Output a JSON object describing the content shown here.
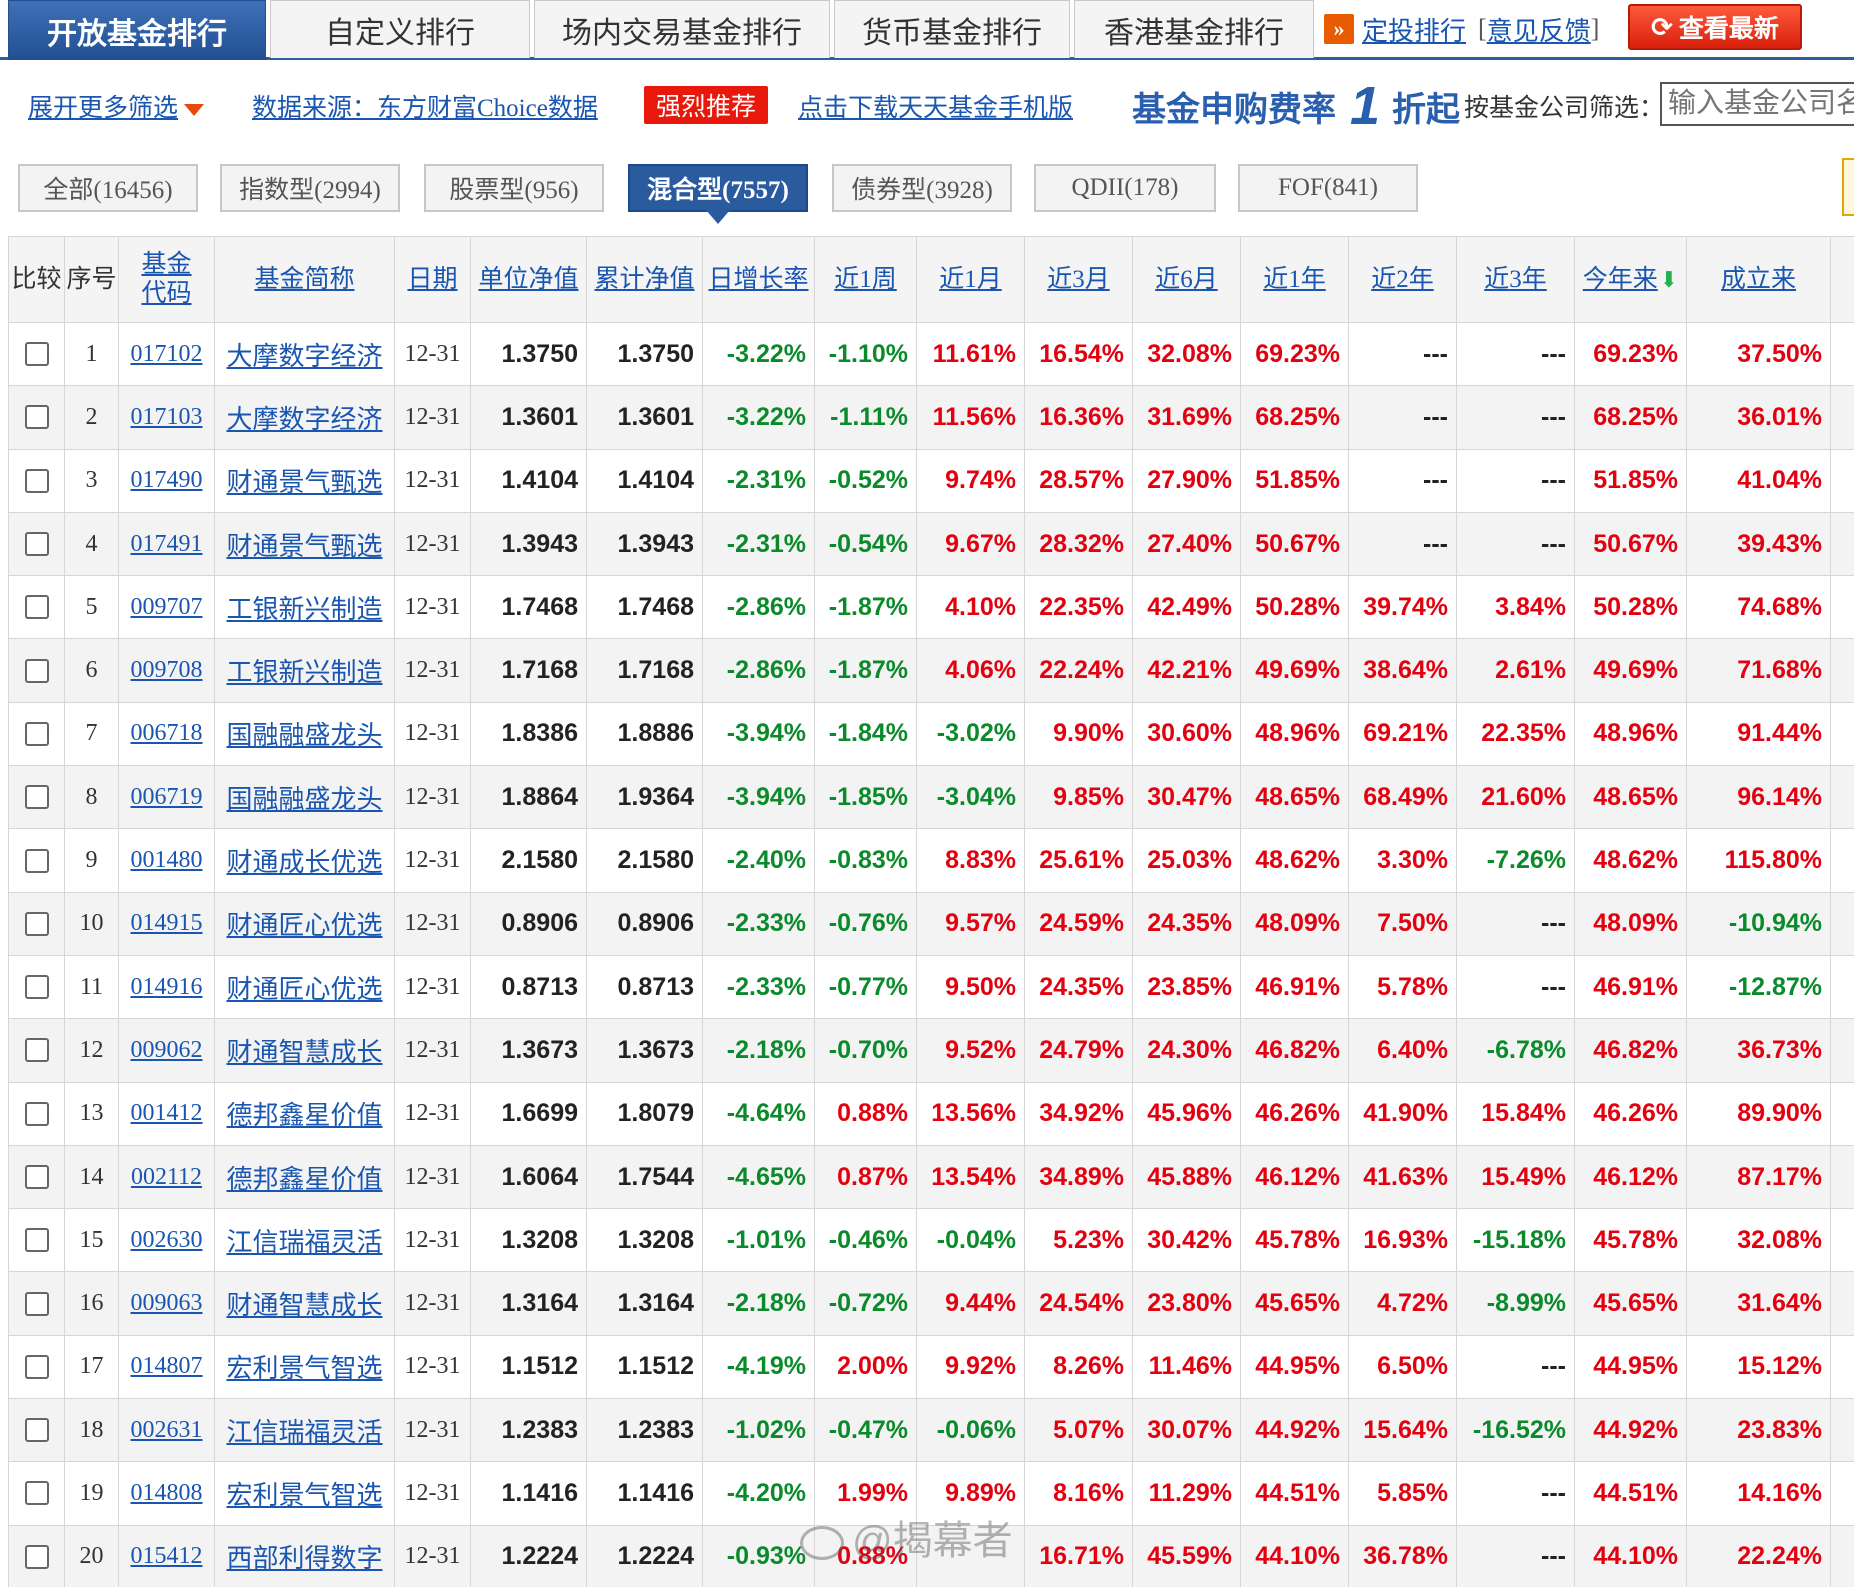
{
  "tabs": [
    "开放基金排行",
    "自定义排行",
    "场内交易基金排行",
    "货币基金排行",
    "香港基金排行"
  ],
  "top_links": {
    "dingtou": "定投排行",
    "feedback_open": "[",
    "feedback": "意见反馈",
    "feedback_close": "]"
  },
  "refresh_label": "查看最新",
  "filter": {
    "expand": "展开更多筛选",
    "source": "数据来源：东方财富Choice数据",
    "recommend": "强烈推荐",
    "download": "点击下载天天基金手机版",
    "fee_text": "基金申购费率",
    "fee_one": "1",
    "fee_suffix": "折起",
    "company_label": "按基金公司筛选：",
    "company_placeholder": "输入基金公司名称"
  },
  "categories": [
    "全部(16456)",
    "指数型(2994)",
    "股票型(956)",
    "混合型(7557)",
    "债券型(3928)",
    "QDII(178)",
    "FOF(841)"
  ],
  "headers": {
    "compare": "比较",
    "no": "序号",
    "code": "基金代码",
    "name": "基金简称",
    "date": "日期",
    "nav": "单位净值",
    "acc_nav": "累计净值",
    "daily": "日增长率",
    "w1": "近1周",
    "m1": "近1月",
    "m3": "近3月",
    "m6": "近6月",
    "y1": "近1年",
    "y2": "近2年",
    "y3": "近3年",
    "ytd": "今年来",
    "since": "成立来"
  },
  "rows": [
    {
      "no": "1",
      "code": "017102",
      "name": "大摩数字经济",
      "date": "12-31",
      "nav": "1.3750",
      "acc": "1.3750",
      "daily": "-3.22%",
      "w1": "-1.10%",
      "m1": "11.61%",
      "m3": "16.54%",
      "m6": "32.08%",
      "y1": "69.23%",
      "y2": "---",
      "y3": "---",
      "ytd": "69.23%",
      "since": "37.50%"
    },
    {
      "no": "2",
      "code": "017103",
      "name": "大摩数字经济",
      "date": "12-31",
      "nav": "1.3601",
      "acc": "1.3601",
      "daily": "-3.22%",
      "w1": "-1.11%",
      "m1": "11.56%",
      "m3": "16.36%",
      "m6": "31.69%",
      "y1": "68.25%",
      "y2": "---",
      "y3": "---",
      "ytd": "68.25%",
      "since": "36.01%"
    },
    {
      "no": "3",
      "code": "017490",
      "name": "财通景气甄选",
      "date": "12-31",
      "nav": "1.4104",
      "acc": "1.4104",
      "daily": "-2.31%",
      "w1": "-0.52%",
      "m1": "9.74%",
      "m3": "28.57%",
      "m6": "27.90%",
      "y1": "51.85%",
      "y2": "---",
      "y3": "---",
      "ytd": "51.85%",
      "since": "41.04%"
    },
    {
      "no": "4",
      "code": "017491",
      "name": "财通景气甄选",
      "date": "12-31",
      "nav": "1.3943",
      "acc": "1.3943",
      "daily": "-2.31%",
      "w1": "-0.54%",
      "m1": "9.67%",
      "m3": "28.32%",
      "m6": "27.40%",
      "y1": "50.67%",
      "y2": "---",
      "y3": "---",
      "ytd": "50.67%",
      "since": "39.43%"
    },
    {
      "no": "5",
      "code": "009707",
      "name": "工银新兴制造",
      "date": "12-31",
      "nav": "1.7468",
      "acc": "1.7468",
      "daily": "-2.86%",
      "w1": "-1.87%",
      "m1": "4.10%",
      "m3": "22.35%",
      "m6": "42.49%",
      "y1": "50.28%",
      "y2": "39.74%",
      "y3": "3.84%",
      "ytd": "50.28%",
      "since": "74.68%"
    },
    {
      "no": "6",
      "code": "009708",
      "name": "工银新兴制造",
      "date": "12-31",
      "nav": "1.7168",
      "acc": "1.7168",
      "daily": "-2.86%",
      "w1": "-1.87%",
      "m1": "4.06%",
      "m3": "22.24%",
      "m6": "42.21%",
      "y1": "49.69%",
      "y2": "38.64%",
      "y3": "2.61%",
      "ytd": "49.69%",
      "since": "71.68%"
    },
    {
      "no": "7",
      "code": "006718",
      "name": "国融融盛龙头",
      "date": "12-31",
      "nav": "1.8386",
      "acc": "1.8886",
      "daily": "-3.94%",
      "w1": "-1.84%",
      "m1": "-3.02%",
      "m3": "9.90%",
      "m6": "30.60%",
      "y1": "48.96%",
      "y2": "69.21%",
      "y3": "22.35%",
      "ytd": "48.96%",
      "since": "91.44%"
    },
    {
      "no": "8",
      "code": "006719",
      "name": "国融融盛龙头",
      "date": "12-31",
      "nav": "1.8864",
      "acc": "1.9364",
      "daily": "-3.94%",
      "w1": "-1.85%",
      "m1": "-3.04%",
      "m3": "9.85%",
      "m6": "30.47%",
      "y1": "48.65%",
      "y2": "68.49%",
      "y3": "21.60%",
      "ytd": "48.65%",
      "since": "96.14%"
    },
    {
      "no": "9",
      "code": "001480",
      "name": "财通成长优选",
      "date": "12-31",
      "nav": "2.1580",
      "acc": "2.1580",
      "daily": "-2.40%",
      "w1": "-0.83%",
      "m1": "8.83%",
      "m3": "25.61%",
      "m6": "25.03%",
      "y1": "48.62%",
      "y2": "3.30%",
      "y3": "-7.26%",
      "ytd": "48.62%",
      "since": "115.80%"
    },
    {
      "no": "10",
      "code": "014915",
      "name": "财通匠心优选",
      "date": "12-31",
      "nav": "0.8906",
      "acc": "0.8906",
      "daily": "-2.33%",
      "w1": "-0.76%",
      "m1": "9.57%",
      "m3": "24.59%",
      "m6": "24.35%",
      "y1": "48.09%",
      "y2": "7.50%",
      "y3": "---",
      "ytd": "48.09%",
      "since": "-10.94%"
    },
    {
      "no": "11",
      "code": "014916",
      "name": "财通匠心优选",
      "date": "12-31",
      "nav": "0.8713",
      "acc": "0.8713",
      "daily": "-2.33%",
      "w1": "-0.77%",
      "m1": "9.50%",
      "m3": "24.35%",
      "m6": "23.85%",
      "y1": "46.91%",
      "y2": "5.78%",
      "y3": "---",
      "ytd": "46.91%",
      "since": "-12.87%"
    },
    {
      "no": "12",
      "code": "009062",
      "name": "财通智慧成长",
      "date": "12-31",
      "nav": "1.3673",
      "acc": "1.3673",
      "daily": "-2.18%",
      "w1": "-0.70%",
      "m1": "9.52%",
      "m3": "24.79%",
      "m6": "24.30%",
      "y1": "46.82%",
      "y2": "6.40%",
      "y3": "-6.78%",
      "ytd": "46.82%",
      "since": "36.73%"
    },
    {
      "no": "13",
      "code": "001412",
      "name": "德邦鑫星价值",
      "date": "12-31",
      "nav": "1.6699",
      "acc": "1.8079",
      "daily": "-4.64%",
      "w1": "0.88%",
      "m1": "13.56%",
      "m3": "34.92%",
      "m6": "45.96%",
      "y1": "46.26%",
      "y2": "41.90%",
      "y3": "15.84%",
      "ytd": "46.26%",
      "since": "89.90%"
    },
    {
      "no": "14",
      "code": "002112",
      "name": "德邦鑫星价值",
      "date": "12-31",
      "nav": "1.6064",
      "acc": "1.7544",
      "daily": "-4.65%",
      "w1": "0.87%",
      "m1": "13.54%",
      "m3": "34.89%",
      "m6": "45.88%",
      "y1": "46.12%",
      "y2": "41.63%",
      "y3": "15.49%",
      "ytd": "46.12%",
      "since": "87.17%"
    },
    {
      "no": "15",
      "code": "002630",
      "name": "江信瑞福灵活",
      "date": "12-31",
      "nav": "1.3208",
      "acc": "1.3208",
      "daily": "-1.01%",
      "w1": "-0.46%",
      "m1": "-0.04%",
      "m3": "5.23%",
      "m6": "30.42%",
      "y1": "45.78%",
      "y2": "16.93%",
      "y3": "-15.18%",
      "ytd": "45.78%",
      "since": "32.08%"
    },
    {
      "no": "16",
      "code": "009063",
      "name": "财通智慧成长",
      "date": "12-31",
      "nav": "1.3164",
      "acc": "1.3164",
      "daily": "-2.18%",
      "w1": "-0.72%",
      "m1": "9.44%",
      "m3": "24.54%",
      "m6": "23.80%",
      "y1": "45.65%",
      "y2": "4.72%",
      "y3": "-8.99%",
      "ytd": "45.65%",
      "since": "31.64%"
    },
    {
      "no": "17",
      "code": "014807",
      "name": "宏利景气智选",
      "date": "12-31",
      "nav": "1.1512",
      "acc": "1.1512",
      "daily": "-4.19%",
      "w1": "2.00%",
      "m1": "9.92%",
      "m3": "8.26%",
      "m6": "11.46%",
      "y1": "44.95%",
      "y2": "6.50%",
      "y3": "---",
      "ytd": "44.95%",
      "since": "15.12%"
    },
    {
      "no": "18",
      "code": "002631",
      "name": "江信瑞福灵活",
      "date": "12-31",
      "nav": "1.2383",
      "acc": "1.2383",
      "daily": "-1.02%",
      "w1": "-0.47%",
      "m1": "-0.06%",
      "m3": "5.07%",
      "m6": "30.07%",
      "y1": "44.92%",
      "y2": "15.64%",
      "y3": "-16.52%",
      "ytd": "44.92%",
      "since": "23.83%"
    },
    {
      "no": "19",
      "code": "014808",
      "name": "宏利景气智选",
      "date": "12-31",
      "nav": "1.1416",
      "acc": "1.1416",
      "daily": "-4.20%",
      "w1": "1.99%",
      "m1": "9.89%",
      "m3": "8.16%",
      "m6": "11.29%",
      "y1": "44.51%",
      "y2": "5.85%",
      "y3": "---",
      "ytd": "44.51%",
      "since": "14.16%"
    },
    {
      "no": "20",
      "code": "015412",
      "name": "西部利得数字",
      "date": "12-31",
      "nav": "1.2224",
      "acc": "1.2224",
      "daily": "-0.93%",
      "w1": "0.88%",
      "m1": "",
      "m3": "16.71%",
      "m6": "45.59%",
      "y1": "44.10%",
      "y2": "36.78%",
      "y3": "---",
      "ytd": "44.10%",
      "since": "22.24%"
    }
  ],
  "watermark": "@揭幕者",
  "colors": {
    "up": "#e3000f",
    "down": "#0b8a2b",
    "link": "#1a56b0",
    "accent": "#2b5b9f"
  }
}
